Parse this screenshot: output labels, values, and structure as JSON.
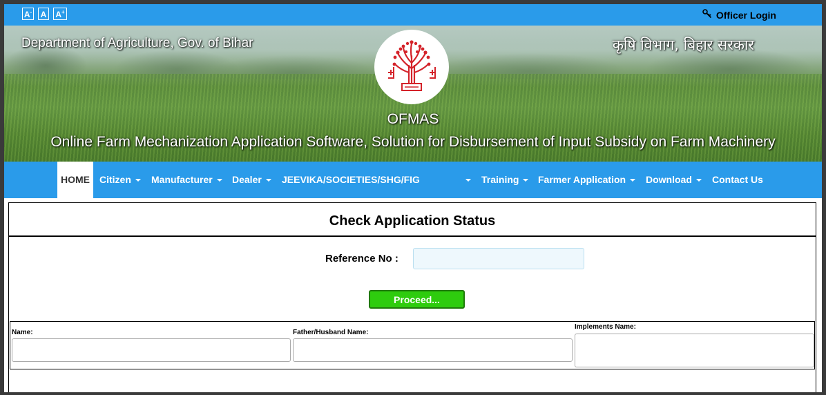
{
  "toolbar": {
    "font_decrease": "A",
    "font_decrease_mark": "-",
    "font_normal": "A",
    "font_increase": "A",
    "font_increase_mark": "+",
    "officer_login": "Officer Login",
    "officer_icon": "key-icon"
  },
  "banner": {
    "dept_en": "Department of Agriculture, Gov. of Bihar",
    "dept_hi": "कृषि विभाग, बिहार सरकार",
    "app_short": "OFMAS",
    "app_full": "Online Farm Mechanization Application Software, Solution for Disbursement of Input Subsidy on Farm Machinery",
    "emblem": "bihar-emblem"
  },
  "nav": {
    "items": [
      {
        "label": "HOME",
        "active": true
      },
      {
        "label": "Citizen",
        "dropdown": true
      },
      {
        "label": "Manufacturer",
        "dropdown": true
      },
      {
        "label": "Dealer",
        "dropdown": true
      },
      {
        "label": "JEEVIKA/SOCIETIES/SHG/FIG",
        "dropdown": true
      },
      {
        "label": "Training",
        "dropdown": true
      },
      {
        "label": "Farmer Application",
        "dropdown": true
      },
      {
        "label": "Download",
        "dropdown": true
      },
      {
        "label": "Contact Us"
      }
    ]
  },
  "status": {
    "title": "Check Application Status",
    "ref_label": "Reference No :",
    "ref_value": "",
    "proceed": "Proceed..."
  },
  "result": {
    "name_label": "Name:",
    "father_label": "Father/Husband Name:",
    "implements_label": "Implements Name:"
  },
  "colors": {
    "accent": "#2a9bea",
    "proceed": "#2ecc0e"
  }
}
